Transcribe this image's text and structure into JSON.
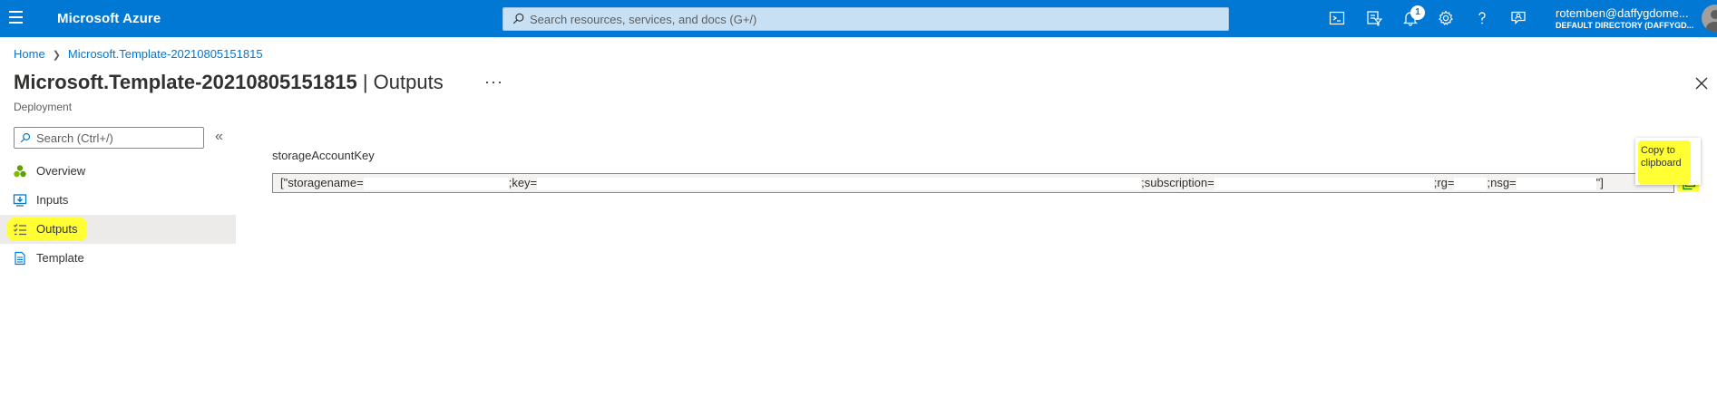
{
  "header": {
    "brand": "Microsoft Azure",
    "search_placeholder": "Search resources, services, and docs (G+/)",
    "notification_count": "1",
    "user_email": "rotemben@daffygdome...",
    "user_directory": "DEFAULT DIRECTORY (DAFFYGD...",
    "icons": [
      "cloud-shell-icon",
      "directory-filter-icon",
      "notifications-bell-icon",
      "settings-gear-icon",
      "help-icon",
      "feedback-icon"
    ]
  },
  "breadcrumb": {
    "home": "Home",
    "current": "Microsoft.Template-20210805151815"
  },
  "page": {
    "title_name": "Microsoft.Template-20210805151815",
    "title_separator": "|",
    "title_section": "Outputs",
    "subtitle": "Deployment",
    "more": "···"
  },
  "sidebar": {
    "search_placeholder": "Search (Ctrl+/)",
    "collapse": "«",
    "items": [
      {
        "label": "Overview",
        "icon": "overview-icon"
      },
      {
        "label": "Inputs",
        "icon": "inputs-icon"
      },
      {
        "label": "Outputs",
        "icon": "outputs-icon",
        "active": true
      },
      {
        "label": "Template",
        "icon": "template-icon"
      }
    ]
  },
  "main": {
    "output_name": "storageAccountKey",
    "value_parts": {
      "p1": "[\"storagename=",
      "p2": ";key=",
      "p3": ";subscription=",
      "p4": ";rg=",
      "p5": ";nsg=",
      "p6": "\"]"
    },
    "tooltip": "Copy to clipboard"
  },
  "colors": {
    "accent": "#0078d4",
    "highlight": "#ffff33",
    "active_nav": "#edebe9"
  }
}
